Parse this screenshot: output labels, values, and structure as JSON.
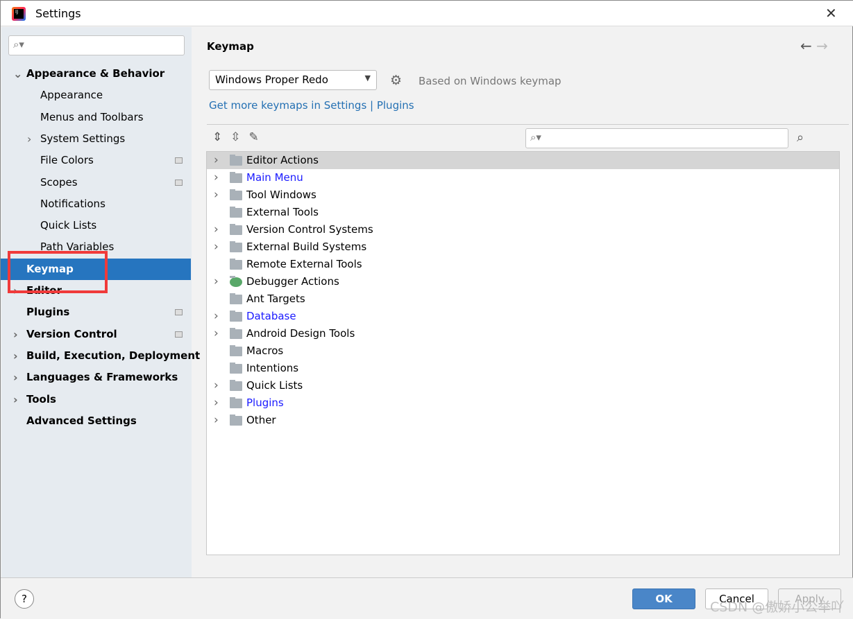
{
  "window": {
    "title": "Settings",
    "close_icon": "close-icon"
  },
  "sidebar": {
    "search_placeholder": "",
    "items": [
      {
        "label": "Appearance & Behavior",
        "bold": true,
        "chevron": "down",
        "indent": 0
      },
      {
        "label": "Appearance",
        "indent": 1
      },
      {
        "label": "Menus and Toolbars",
        "indent": 1
      },
      {
        "label": "System Settings",
        "indent": 1,
        "chevron": "right"
      },
      {
        "label": "File Colors",
        "indent": 1,
        "badge": true
      },
      {
        "label": "Scopes",
        "indent": 1,
        "badge": true
      },
      {
        "label": "Notifications",
        "indent": 1
      },
      {
        "label": "Quick Lists",
        "indent": 1
      },
      {
        "label": "Path Variables",
        "indent": 1
      },
      {
        "label": "Keymap",
        "bold": true,
        "selected": true,
        "indent": 0
      },
      {
        "label": "Editor",
        "bold": true,
        "chevron": "right",
        "indent": 0
      },
      {
        "label": "Plugins",
        "bold": true,
        "badge": true,
        "indent": 0
      },
      {
        "label": "Version Control",
        "bold": true,
        "chevron": "right",
        "badge": true,
        "indent": 0
      },
      {
        "label": "Build, Execution, Deployment",
        "bold": true,
        "chevron": "right",
        "indent": 0
      },
      {
        "label": "Languages & Frameworks",
        "bold": true,
        "chevron": "right",
        "indent": 0
      },
      {
        "label": "Tools",
        "bold": true,
        "chevron": "right",
        "indent": 0
      },
      {
        "label": "Advanced Settings",
        "bold": true,
        "indent": 0
      }
    ]
  },
  "main": {
    "title": "Keymap",
    "keymap_selected": "Windows Proper Redo",
    "based_on": "Based on Windows keymap",
    "link": "Get more keymaps in Settings | Plugins",
    "tree_search_placeholder": ""
  },
  "tree": [
    {
      "label": "Editor Actions",
      "expandable": true,
      "selected": true
    },
    {
      "label": "Main Menu",
      "expandable": true,
      "blue": true
    },
    {
      "label": "Tool Windows",
      "expandable": true
    },
    {
      "label": "External Tools"
    },
    {
      "label": "Version Control Systems",
      "expandable": true
    },
    {
      "label": "External Build Systems",
      "expandable": true
    },
    {
      "label": "Remote External Tools"
    },
    {
      "label": "Debugger Actions",
      "expandable": true,
      "icon": "bug-icon"
    },
    {
      "label": "Ant Targets"
    },
    {
      "label": "Database",
      "expandable": true,
      "blue": true
    },
    {
      "label": "Android Design Tools",
      "expandable": true
    },
    {
      "label": "Macros"
    },
    {
      "label": "Intentions"
    },
    {
      "label": "Quick Lists",
      "expandable": true
    },
    {
      "label": "Plugins",
      "expandable": true,
      "blue": true
    },
    {
      "label": "Other",
      "expandable": true
    }
  ],
  "footer": {
    "help": "?",
    "ok": "OK",
    "cancel": "Cancel",
    "apply": "Apply"
  },
  "watermark": "CSDN @傲娇小公举吖",
  "colors": {
    "selection": "#2675bf",
    "link": "#2470b3",
    "highlight_box": "#f03a3a",
    "ok_button": "#4a86c8"
  }
}
